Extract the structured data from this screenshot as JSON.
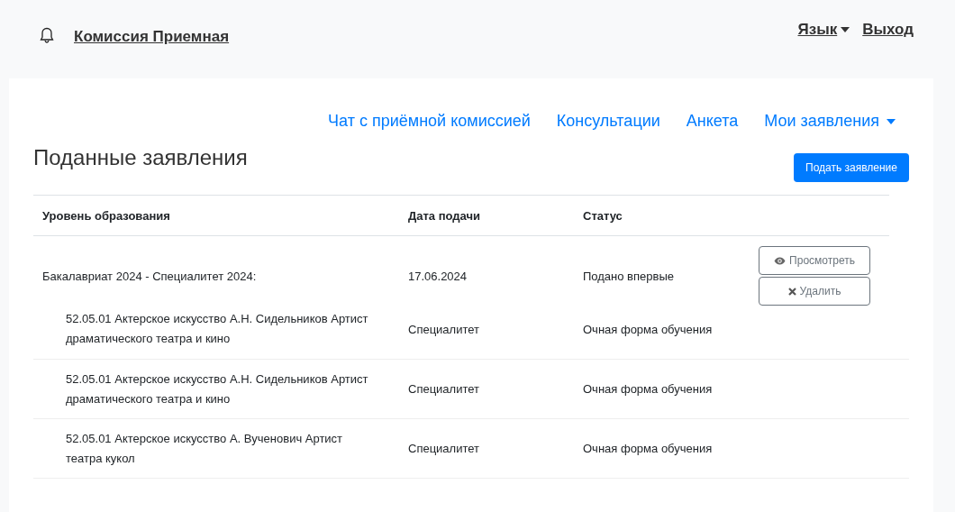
{
  "header": {
    "title": "Комиссия Приемная",
    "language": "Язык",
    "logout": "Выход"
  },
  "nav": [
    {
      "label": "Чат с приёмной комиссией",
      "dropdown": false
    },
    {
      "label": "Консультации",
      "dropdown": false
    },
    {
      "label": "Анкета",
      "dropdown": false
    },
    {
      "label": "Мои заявления",
      "dropdown": true
    }
  ],
  "heading": "Поданные заявления",
  "submit_button": "Подать заявление",
  "table": {
    "columns": [
      "Уровень образования",
      "Дата подачи",
      "Статус"
    ],
    "applications": [
      {
        "level": "Бакалавриат 2024 - Специалитет 2024:",
        "date": "17.06.2024",
        "status": "Подано впервые",
        "view_button": "Просмотреть",
        "delete_button": "Удалить",
        "programs": [
          {
            "name": "52.05.01 Актерское искусство А.Н. Сидельников Артист драматического театра и кино",
            "level": "Специалитет",
            "form": "Очная форма обучения"
          },
          {
            "name": "52.05.01 Актерское искусство А.Н. Сидельников Артист драматического театра и кино",
            "level": "Специалитет",
            "form": "Очная форма обучения"
          },
          {
            "name": "52.05.01 Актерское искусство А. Вученович Артист театра кукол",
            "level": "Специалитет",
            "form": "Очная форма обучения"
          }
        ]
      }
    ]
  }
}
